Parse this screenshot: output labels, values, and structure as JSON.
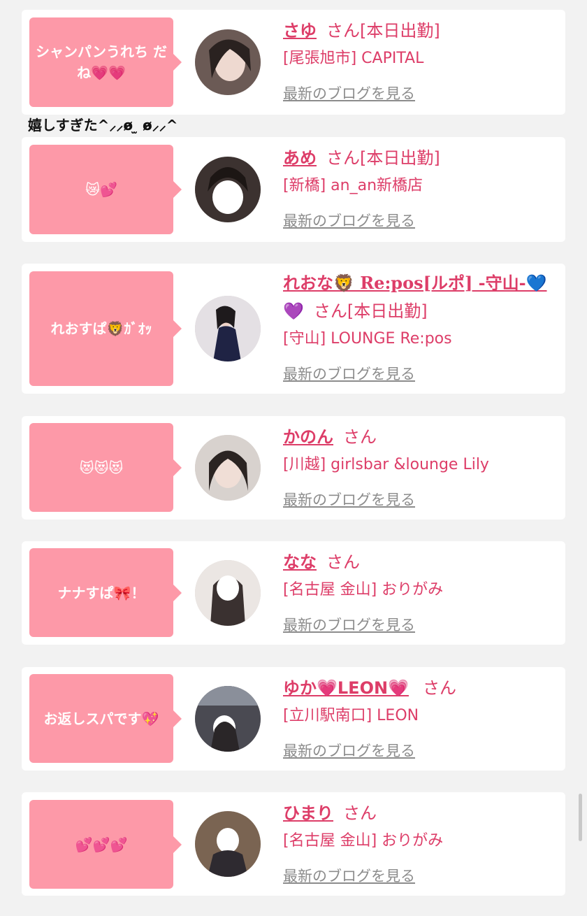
{
  "caption": "嬉しすぎた^⸝⸝ɵ̷ ̫ ɵ̷⸝⸝^",
  "suffix_san": "さん",
  "blog_link": "最新のブログを見る",
  "accent": "#dd3d68",
  "bubble_color": "#fd99a8",
  "cards": [
    {
      "bubble": "シャンパンうれち だね💗💗",
      "name": "さゆ",
      "name2": "",
      "status": "[本日出勤]",
      "shop": "[尾張旭市] CAPITAL"
    },
    {
      "bubble": "😿💕",
      "name": "あめ",
      "name2": "",
      "status": "[本日出勤]",
      "shop": "[新橋] an_an新橋店"
    },
    {
      "bubble": "れおすぱ🦁ｶﾞｵｯ",
      "name": "れおな🦁 Re:pos[ルポ] -守山-💙",
      "name2": "💜",
      "status": "[本日出勤]",
      "shop": "[守山] LOUNGE Re:pos"
    },
    {
      "bubble": "😻😻😻",
      "name": "かのん",
      "name2": "",
      "status": "",
      "shop": "[川越] girlsbar &lounge Lily"
    },
    {
      "bubble": "ナナすぱ🎀！",
      "name": "なな",
      "name2": "",
      "status": "",
      "shop": "[名古屋 金山] おりがみ"
    },
    {
      "bubble": "お返しスパです💖",
      "name": "ゆか💗LEON💗",
      "name2": "",
      "status": "",
      "shop": "[立川駅南口] LEON"
    },
    {
      "bubble": "💕💕💕",
      "name": "ひまり",
      "name2": "",
      "status": "",
      "shop": "[名古屋 金山] おりがみ"
    }
  ]
}
